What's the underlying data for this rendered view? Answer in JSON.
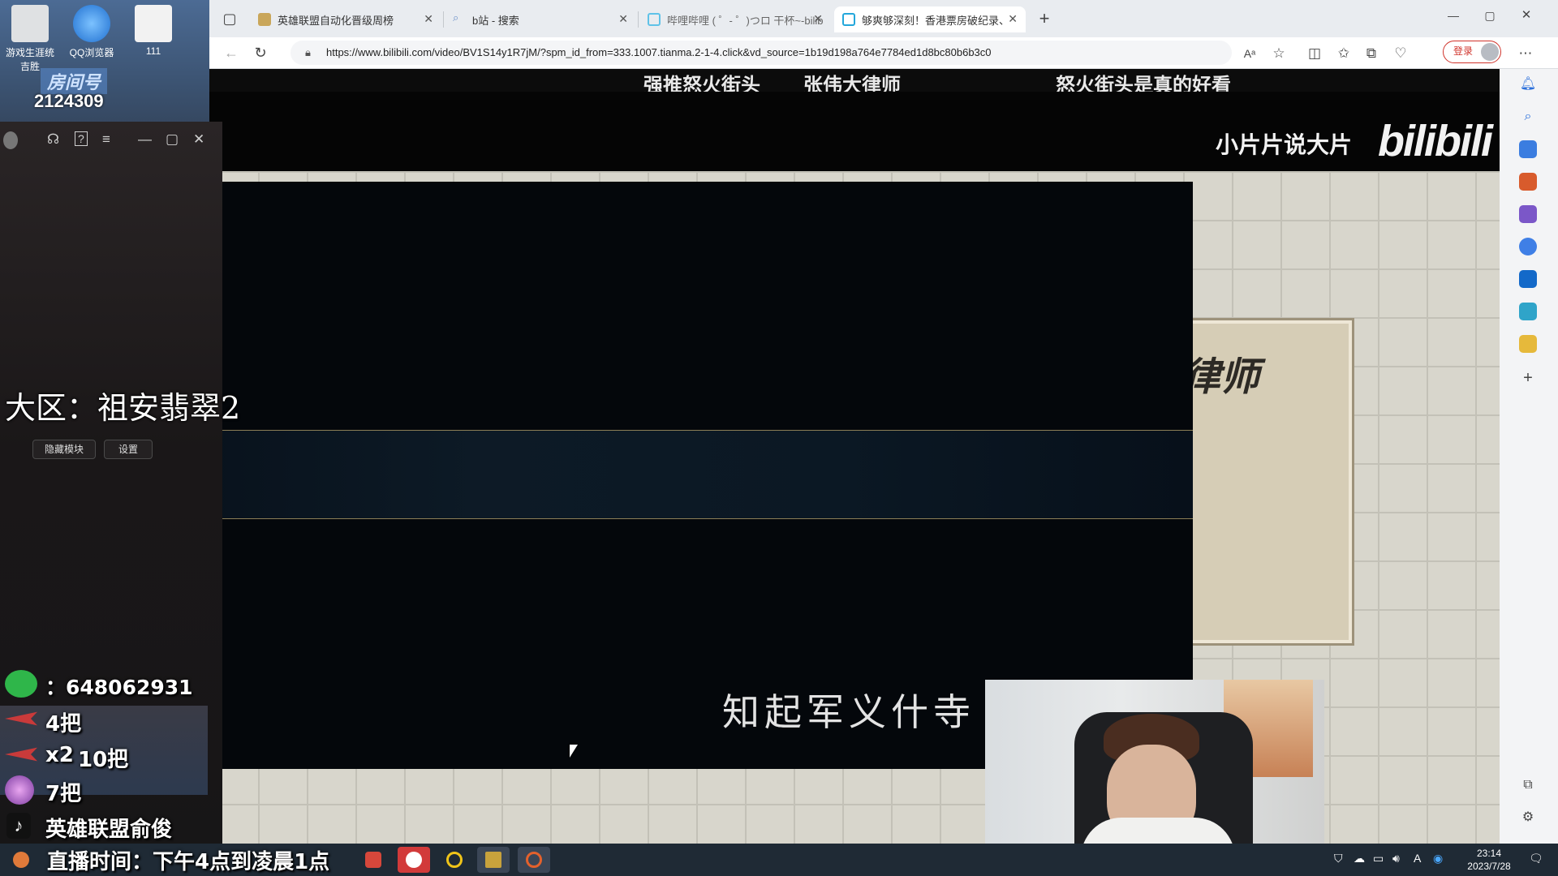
{
  "desktop": {
    "icons": [
      {
        "label": "游戏生涯统\n吉胜",
        "color": "#d6d8da"
      },
      {
        "label": "QQ浏览器",
        "color": "#3b8ee0"
      },
      {
        "label": "111",
        "color": "#e8e8e8"
      }
    ],
    "room_label": "房间号",
    "room_number": "2124309"
  },
  "browser": {
    "tabs": [
      {
        "label": "英雄联盟自动化晋级周榜",
        "active": false
      },
      {
        "label": "b站 - 搜索",
        "active": false
      },
      {
        "label": "哔哩哔哩 ( ゜- ゜)つロ 干杯~-bilib",
        "active": false
      },
      {
        "label": "够爽够深刻！香港票房破纪录、",
        "active": true
      }
    ],
    "url": "https://www.bilibili.com/video/BV1S14y1R7jM/?spm_id_from=333.1007.tianma.2-1-4.click&vd_source=1b19d198a764e7784ed1d8bc80b6b3c0",
    "login_label": "登录"
  },
  "video": {
    "top_titles": [
      "强推怒火街头",
      "张伟大律师",
      "怒火街头是真的好看"
    ],
    "brand_text": "小片片说大片",
    "brand_logo": "bilibili",
    "paper_text": "律师",
    "subtitle": "知起军义什寺"
  },
  "panel": {
    "hide_label": "隐藏模块",
    "settings_label": "设置",
    "region_text": "大区：祖安翡翠2"
  },
  "overlays": {
    "wechat_id": "：648062931",
    "stat1": "4把",
    "stat2_mult": "x2",
    "stat2": "10把",
    "stat3": "7把",
    "douyin": "英雄联盟俞俊",
    "schedule": "直播时间：下午4点到凌晨1点"
  },
  "taskbar": {
    "time": "23:14",
    "date": "2023/7/28"
  }
}
